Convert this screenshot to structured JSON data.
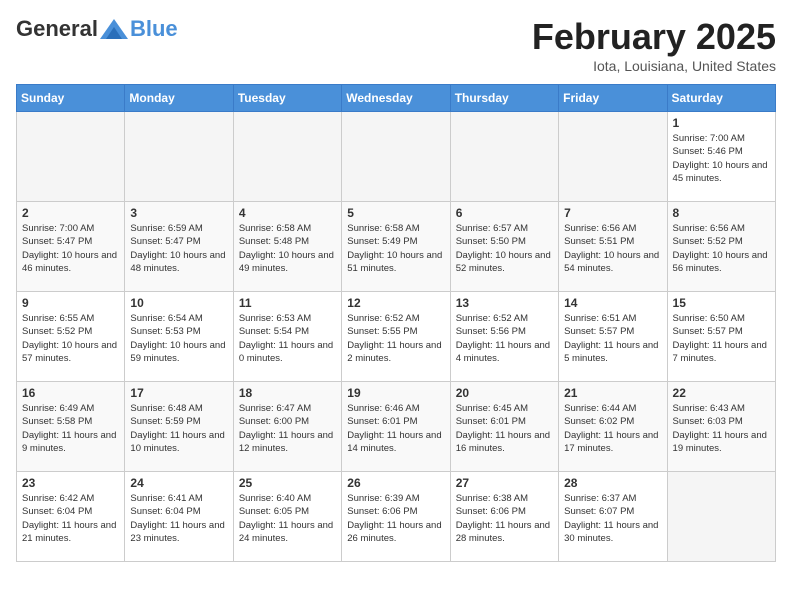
{
  "header": {
    "logo_general": "General",
    "logo_blue": "Blue",
    "month_title": "February 2025",
    "location": "Iota, Louisiana, United States"
  },
  "calendar": {
    "days_of_week": [
      "Sunday",
      "Monday",
      "Tuesday",
      "Wednesday",
      "Thursday",
      "Friday",
      "Saturday"
    ],
    "weeks": [
      [
        {
          "day": "",
          "info": ""
        },
        {
          "day": "",
          "info": ""
        },
        {
          "day": "",
          "info": ""
        },
        {
          "day": "",
          "info": ""
        },
        {
          "day": "",
          "info": ""
        },
        {
          "day": "",
          "info": ""
        },
        {
          "day": "1",
          "info": "Sunrise: 7:00 AM\nSunset: 5:46 PM\nDaylight: 10 hours and 45 minutes."
        }
      ],
      [
        {
          "day": "2",
          "info": "Sunrise: 7:00 AM\nSunset: 5:47 PM\nDaylight: 10 hours and 46 minutes."
        },
        {
          "day": "3",
          "info": "Sunrise: 6:59 AM\nSunset: 5:47 PM\nDaylight: 10 hours and 48 minutes."
        },
        {
          "day": "4",
          "info": "Sunrise: 6:58 AM\nSunset: 5:48 PM\nDaylight: 10 hours and 49 minutes."
        },
        {
          "day": "5",
          "info": "Sunrise: 6:58 AM\nSunset: 5:49 PM\nDaylight: 10 hours and 51 minutes."
        },
        {
          "day": "6",
          "info": "Sunrise: 6:57 AM\nSunset: 5:50 PM\nDaylight: 10 hours and 52 minutes."
        },
        {
          "day": "7",
          "info": "Sunrise: 6:56 AM\nSunset: 5:51 PM\nDaylight: 10 hours and 54 minutes."
        },
        {
          "day": "8",
          "info": "Sunrise: 6:56 AM\nSunset: 5:52 PM\nDaylight: 10 hours and 56 minutes."
        }
      ],
      [
        {
          "day": "9",
          "info": "Sunrise: 6:55 AM\nSunset: 5:52 PM\nDaylight: 10 hours and 57 minutes."
        },
        {
          "day": "10",
          "info": "Sunrise: 6:54 AM\nSunset: 5:53 PM\nDaylight: 10 hours and 59 minutes."
        },
        {
          "day": "11",
          "info": "Sunrise: 6:53 AM\nSunset: 5:54 PM\nDaylight: 11 hours and 0 minutes."
        },
        {
          "day": "12",
          "info": "Sunrise: 6:52 AM\nSunset: 5:55 PM\nDaylight: 11 hours and 2 minutes."
        },
        {
          "day": "13",
          "info": "Sunrise: 6:52 AM\nSunset: 5:56 PM\nDaylight: 11 hours and 4 minutes."
        },
        {
          "day": "14",
          "info": "Sunrise: 6:51 AM\nSunset: 5:57 PM\nDaylight: 11 hours and 5 minutes."
        },
        {
          "day": "15",
          "info": "Sunrise: 6:50 AM\nSunset: 5:57 PM\nDaylight: 11 hours and 7 minutes."
        }
      ],
      [
        {
          "day": "16",
          "info": "Sunrise: 6:49 AM\nSunset: 5:58 PM\nDaylight: 11 hours and 9 minutes."
        },
        {
          "day": "17",
          "info": "Sunrise: 6:48 AM\nSunset: 5:59 PM\nDaylight: 11 hours and 10 minutes."
        },
        {
          "day": "18",
          "info": "Sunrise: 6:47 AM\nSunset: 6:00 PM\nDaylight: 11 hours and 12 minutes."
        },
        {
          "day": "19",
          "info": "Sunrise: 6:46 AM\nSunset: 6:01 PM\nDaylight: 11 hours and 14 minutes."
        },
        {
          "day": "20",
          "info": "Sunrise: 6:45 AM\nSunset: 6:01 PM\nDaylight: 11 hours and 16 minutes."
        },
        {
          "day": "21",
          "info": "Sunrise: 6:44 AM\nSunset: 6:02 PM\nDaylight: 11 hours and 17 minutes."
        },
        {
          "day": "22",
          "info": "Sunrise: 6:43 AM\nSunset: 6:03 PM\nDaylight: 11 hours and 19 minutes."
        }
      ],
      [
        {
          "day": "23",
          "info": "Sunrise: 6:42 AM\nSunset: 6:04 PM\nDaylight: 11 hours and 21 minutes."
        },
        {
          "day": "24",
          "info": "Sunrise: 6:41 AM\nSunset: 6:04 PM\nDaylight: 11 hours and 23 minutes."
        },
        {
          "day": "25",
          "info": "Sunrise: 6:40 AM\nSunset: 6:05 PM\nDaylight: 11 hours and 24 minutes."
        },
        {
          "day": "26",
          "info": "Sunrise: 6:39 AM\nSunset: 6:06 PM\nDaylight: 11 hours and 26 minutes."
        },
        {
          "day": "27",
          "info": "Sunrise: 6:38 AM\nSunset: 6:06 PM\nDaylight: 11 hours and 28 minutes."
        },
        {
          "day": "28",
          "info": "Sunrise: 6:37 AM\nSunset: 6:07 PM\nDaylight: 11 hours and 30 minutes."
        },
        {
          "day": "",
          "info": ""
        }
      ]
    ]
  }
}
